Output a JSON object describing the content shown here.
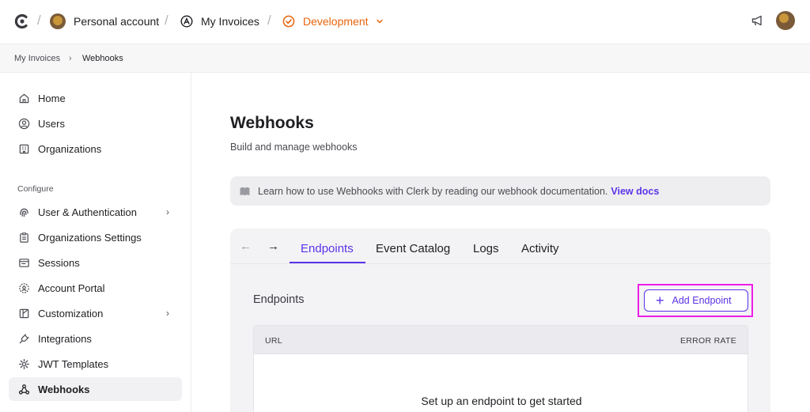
{
  "topbar": {
    "account": "Personal account",
    "app": "My Invoices",
    "env": "Development",
    "separator": "/"
  },
  "breadcrumb": {
    "parent": "My Invoices",
    "current": "Webhooks",
    "arrow": "›"
  },
  "sidebar": {
    "items_top": [
      {
        "label": "Home",
        "icon": "home-icon"
      },
      {
        "label": "Users",
        "icon": "user-circle-icon"
      },
      {
        "label": "Organizations",
        "icon": "building-icon"
      }
    ],
    "section_label": "Configure",
    "items_config": [
      {
        "label": "User & Authentication",
        "icon": "fingerprint-icon",
        "chevron": "›"
      },
      {
        "label": "Organizations Settings",
        "icon": "clipboard-icon"
      },
      {
        "label": "Sessions",
        "icon": "browser-icon"
      },
      {
        "label": "Account Portal",
        "icon": "portal-icon"
      },
      {
        "label": "Customization",
        "icon": "palette-icon",
        "chevron": "›"
      },
      {
        "label": "Integrations",
        "icon": "plug-icon"
      },
      {
        "label": "JWT Templates",
        "icon": "gear-icon"
      },
      {
        "label": "Webhooks",
        "icon": "webhook-icon",
        "active": true
      }
    ]
  },
  "main": {
    "title": "Webhooks",
    "subtitle": "Build and manage webhooks",
    "banner": {
      "text": "Learn how to use Webhooks with Clerk by reading our webhook documentation.",
      "link": "View docs"
    },
    "tabs": {
      "back_arrow": "←",
      "forward_arrow": "→",
      "items": [
        "Endpoints",
        "Event Catalog",
        "Logs",
        "Activity"
      ],
      "active": "Endpoints"
    },
    "section_label": "Endpoints",
    "add_button": {
      "plus": "+",
      "label": "Add Endpoint"
    },
    "table": {
      "col_url": "URL",
      "col_error_rate": "ERROR RATE",
      "empty_text": "Set up an endpoint to get started"
    }
  },
  "colors": {
    "accent": "#5b33e6",
    "env": "#e8640c",
    "highlight": "#ee1ee6"
  }
}
